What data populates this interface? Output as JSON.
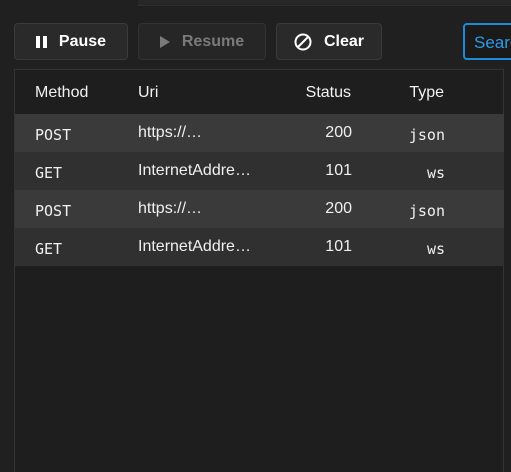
{
  "toolbar": {
    "pause_label": "Pause",
    "resume_label": "Resume",
    "clear_label": "Clear",
    "search_text": "Search"
  },
  "columns": [
    "Method",
    "Uri",
    "Status",
    "Type"
  ],
  "rows": [
    {
      "method": "POST",
      "uri": "https://…",
      "status": "200",
      "type": "json"
    },
    {
      "method": "GET",
      "uri": "InternetAddre…",
      "status": "101",
      "type": "ws"
    },
    {
      "method": "POST",
      "uri": "https://…",
      "status": "200",
      "type": "json"
    },
    {
      "method": "GET",
      "uri": "InternetAddre…",
      "status": "101",
      "type": "ws"
    }
  ],
  "colors": {
    "accent": "#1e8ad6",
    "background": "#202020",
    "row_alt": "#3a3a3a",
    "row": "#303030"
  },
  "icons": {
    "pause": "pause-icon",
    "resume": "play-icon",
    "clear": "block-icon"
  }
}
